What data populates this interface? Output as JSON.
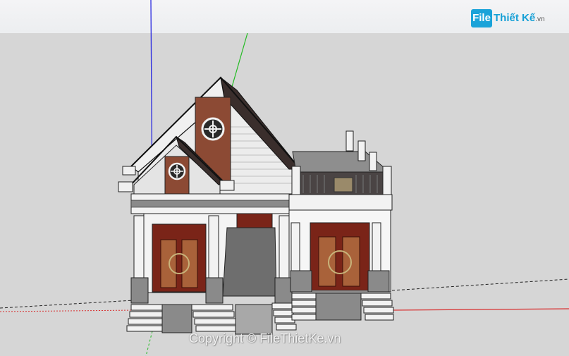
{
  "watermark": {
    "logo_badge": "File",
    "logo_word": "Thiết Kế",
    "logo_domain": ".vn",
    "copyright": "Copyright © FileThietKe.vn"
  },
  "colors": {
    "blue_axis": "#2a2ae0",
    "green_axis": "#22bb22",
    "red_axis": "#d83030",
    "roof": "#3a2e2c",
    "brick": "#8c4a34",
    "wall": "#f2f2f2",
    "door": "#7a2418",
    "stone": "#8a8a8a",
    "logo_blue": "#1aa3d9"
  }
}
